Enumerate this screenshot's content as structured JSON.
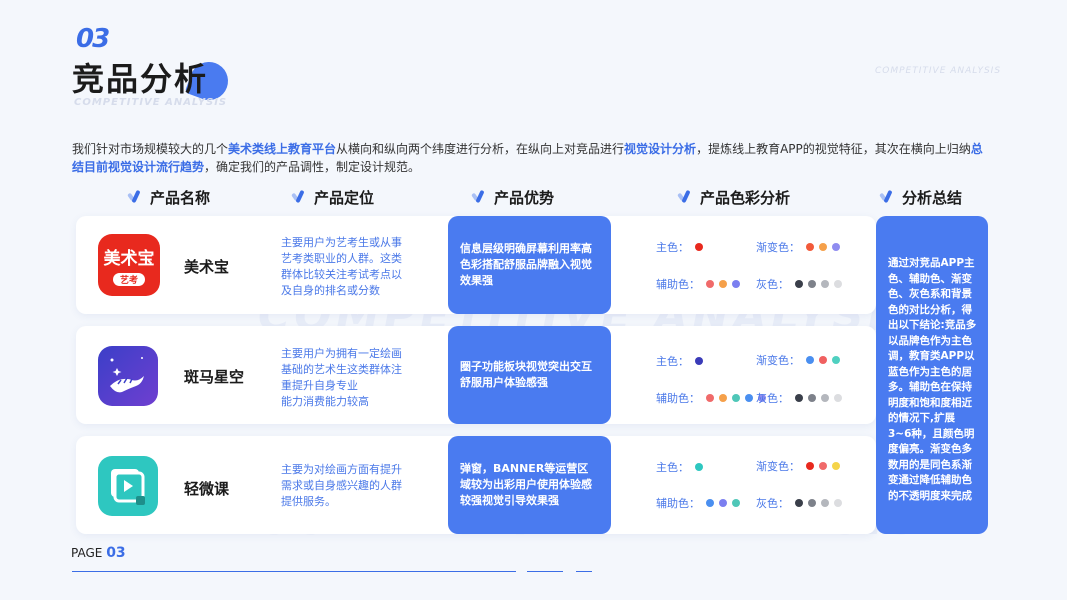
{
  "header": {
    "section_number": "03",
    "title": "竞品分析",
    "title_en": "COMPETITIVE ANALYSIS",
    "corner_en": "COMPETITIVE ANALYSIS"
  },
  "intro": {
    "p1": "我们针对市场规模较大的几个",
    "h1": "美术类线上教育平台",
    "p2": "从横向和纵向两个纬度进行分析，在纵向上对竞品进行",
    "h2": "视觉设计分析",
    "p3": "，提炼线上教育APP的视觉特征，其次在横向上归纳",
    "h3": "总结目前视觉设计流行趋势",
    "p4": "，确定我们的产品调性，制定设计规范。"
  },
  "columns": {
    "name": "产品名称",
    "positioning": "产品定位",
    "advantage": "产品优势",
    "color_analysis": "产品色彩分析",
    "summary": "分析总结"
  },
  "color_labels": {
    "main": "主色：",
    "gradient": "渐变色：",
    "auxiliary": "辅助色：",
    "gray": "灰色："
  },
  "products": [
    {
      "name": "美术宝",
      "icon_name": "meishubao-app-icon",
      "icon_text_main": "美术宝",
      "icon_text_sub": "艺考",
      "positioning": [
        "主要用户为艺考生或从事",
        "艺考类职业的人群。这类",
        "群体比较关注考试考点以",
        "及自身的排名或分数"
      ],
      "advantage": "信息层级明确屏幕利用率高色彩搭配舒服品牌融入视觉效果强",
      "main_colors": [
        "#e8291e"
      ],
      "gradient_colors": [
        "#f25a3a",
        "#f5a04a",
        "#8f8cf0"
      ],
      "auxiliary_colors": [
        "#f06a6a",
        "#f5a04a",
        "#7b7ff0"
      ],
      "gray_colors": [
        "#3a3f4a",
        "#7d818a",
        "#b4b7bd",
        "#dcdde0"
      ]
    },
    {
      "name": "斑马星空",
      "icon_name": "banma-xingkong-app-icon",
      "positioning": [
        "主要用户为拥有一定绘画",
        "基础的艺术生这类群体注",
        "重提升自身专业",
        "能力消费能力较高"
      ],
      "advantage": "圈子功能板块视觉突出交互舒服用户体验感强",
      "main_colors": [
        "#3a3bb8"
      ],
      "gradient_colors": [
        "#4a8ff0",
        "#f06060",
        "#4fd0c0"
      ],
      "auxiliary_colors": [
        "#f06a6a",
        "#f5a04a",
        "#4fc7b8",
        "#4a8ff0",
        "#8f8cf0"
      ],
      "gray_colors": [
        "#3a3f4a",
        "#7d818a",
        "#b4b7bd",
        "#dcdde0"
      ]
    },
    {
      "name": "轻微课",
      "icon_name": "qingweike-app-icon",
      "positioning": [
        "主要为对绘画方面有提升",
        "需求或自身感兴趣的人群",
        "提供服务。"
      ],
      "advantage": "弹窗，BANNER等运营区域较为出彩用户使用体验感较强视觉引导效果强",
      "main_colors": [
        "#2ec7c0"
      ],
      "gradient_colors": [
        "#e8291e",
        "#f06a6a",
        "#f5d44a"
      ],
      "auxiliary_colors": [
        "#4a8ff0",
        "#7b7ff0",
        "#4fc7b8"
      ],
      "gray_colors": [
        "#3a3f4a",
        "#7d818a",
        "#b4b7bd",
        "#dcdde0"
      ]
    }
  ],
  "summary_text": "通过对竞品APP主色、辅助色、渐变色、灰色系和背景色的对比分析，得出以下结论:竞品多以品牌色作为主色调，教育类APP以蓝色作为主色的居多。辅助色在保持明度和饱和度相近的情况下,扩展3~6种，且颜色明度偏亮。渐变色多数用的是同色系渐变通过降低辅助色的不透明度来完成",
  "watermark": "COMPETITIVE ANALYSIS",
  "footer": {
    "page_label": "PAGE",
    "page_number": "03"
  },
  "colors": {
    "accent": "#3b6de6",
    "card_blue": "#4a7bf0",
    "background": "#f4f7fc"
  }
}
